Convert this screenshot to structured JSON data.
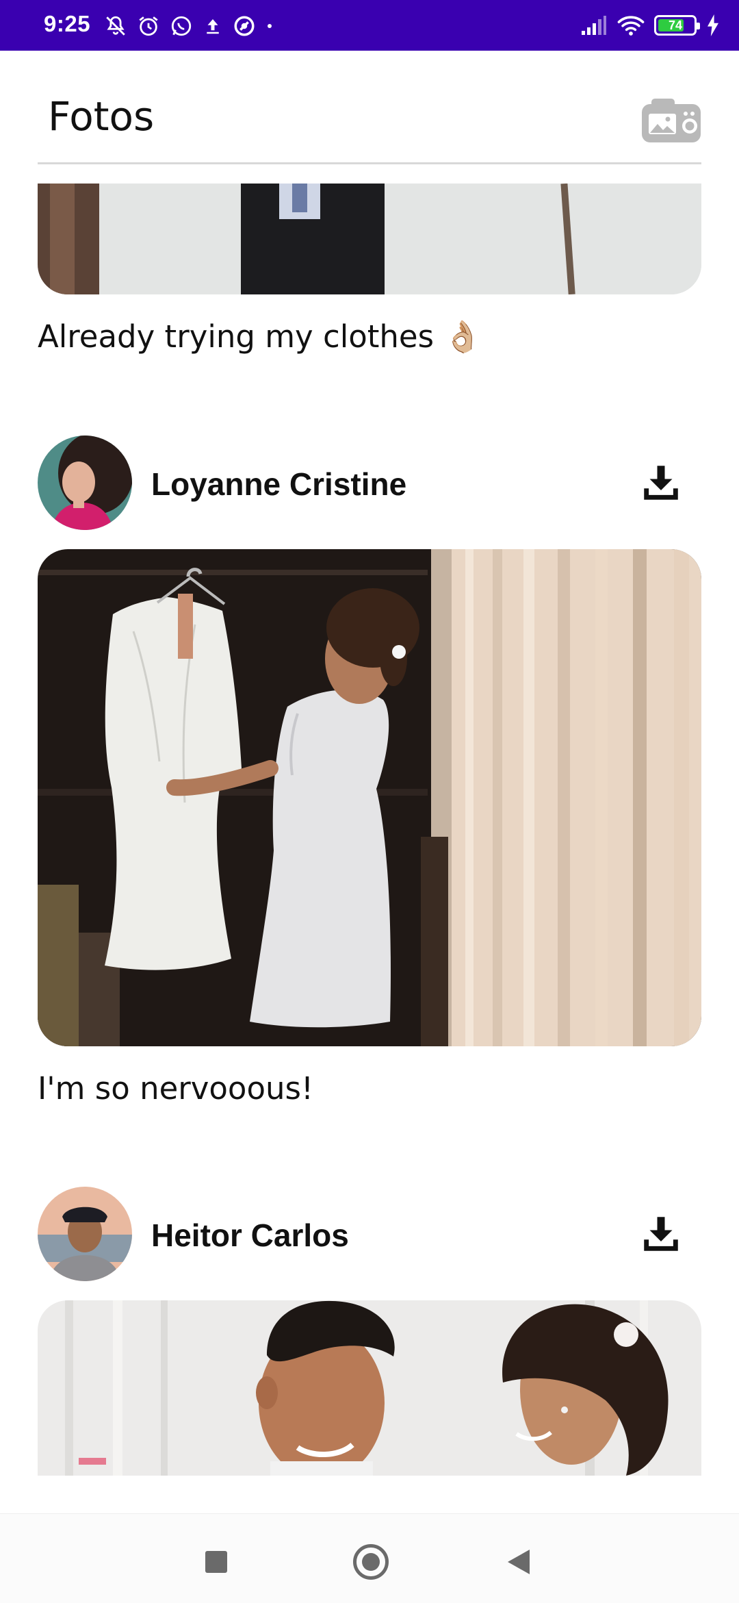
{
  "status_bar": {
    "time": "9:25",
    "battery_level": "74",
    "battery_fraction": 0.74,
    "icons_left": [
      "mute-icon",
      "alarm-icon",
      "whatsapp-icon",
      "upload-icon",
      "target-icon",
      "dot-icon"
    ],
    "icons_right": [
      "signal-icon",
      "wifi-icon",
      "battery-icon",
      "charging-icon"
    ]
  },
  "header": {
    "title": "Fotos",
    "camera_icon": "camera-icon"
  },
  "posts": [
    {
      "caption": "Already trying my clothes 👌🏼"
    },
    {
      "author": "Loyanne Cristine",
      "caption": "I'm so nervooous!",
      "download_icon": "download-icon"
    },
    {
      "author": "Heitor Carlos",
      "download_icon": "download-icon"
    }
  ],
  "colors": {
    "status_bar": "#3a00b0",
    "accent_battery": "#2ecc40",
    "text": "#111111",
    "nav_icons": "#6a6a6a"
  },
  "nav": {
    "recents_icon": "square-icon",
    "home_icon": "circle-icon",
    "back_icon": "back-triangle-icon"
  }
}
